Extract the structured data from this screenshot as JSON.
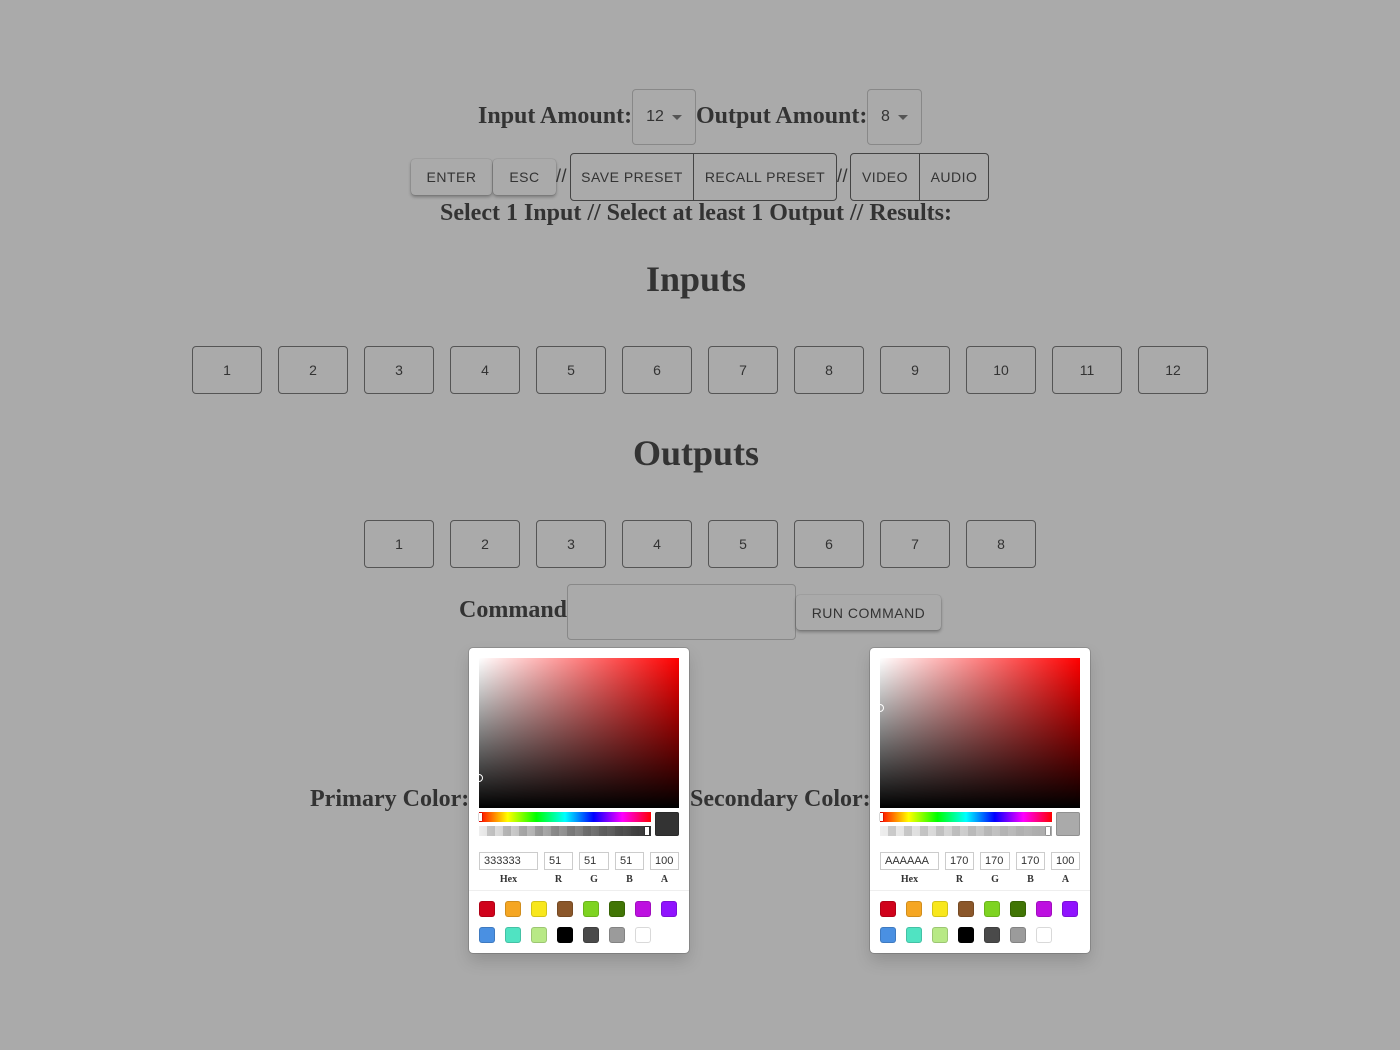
{
  "header": {
    "input_amount_label": "Input Amount:",
    "input_amount_value": "12",
    "output_amount_label": "Output Amount:",
    "output_amount_value": "8"
  },
  "toolbar": {
    "enter": "ENTER",
    "esc": "ESC",
    "sep1": "//",
    "save_preset": "SAVE PRESET",
    "recall_preset": "RECALL PRESET",
    "sep2": "//",
    "video": "VIDEO",
    "audio": "AUDIO"
  },
  "status": "Select 1 Input // Select at least 1 Output // Results:",
  "inputs": {
    "title": "Inputs",
    "items": [
      "1",
      "2",
      "3",
      "4",
      "5",
      "6",
      "7",
      "8",
      "9",
      "10",
      "11",
      "12"
    ]
  },
  "outputs": {
    "title": "Outputs",
    "items": [
      "1",
      "2",
      "3",
      "4",
      "5",
      "6",
      "7",
      "8"
    ]
  },
  "command": {
    "label": "Command",
    "value": "",
    "run_label": "RUN COMMAND"
  },
  "primary": {
    "label": "Primary Color:",
    "hex": "333333",
    "r": "51",
    "g": "51",
    "b": "51",
    "a": "100",
    "color": "#333333"
  },
  "secondary": {
    "label": "Secondary Color:",
    "hex": "AAAAAA",
    "r": "170",
    "g": "170",
    "b": "170",
    "a": "100",
    "color": "#aaaaaa"
  },
  "field_labels": {
    "hex": "Hex",
    "r": "R",
    "g": "G",
    "b": "B",
    "a": "A"
  },
  "swatches": [
    "#D0021B",
    "#F5A623",
    "#F8E71C",
    "#8B572A",
    "#7ED321",
    "#417505",
    "#BD10E0",
    "#9013FE",
    "#4A90E2",
    "#50E3C2",
    "#B8E986",
    "#000000",
    "#4A4A4A",
    "#9B9B9B",
    "#FFFFFF"
  ]
}
